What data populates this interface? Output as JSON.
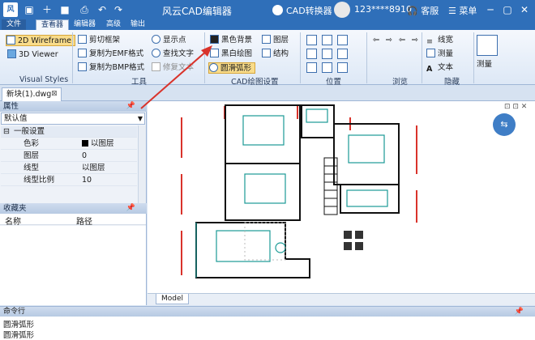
{
  "titlebar": {
    "logo": "风",
    "title": "风云CAD编辑器",
    "converter": "CAD转换器",
    "user": "123****8910",
    "service": "客服",
    "menu": "菜单",
    "quick_icons": [
      "open-icon",
      "new-icon",
      "save-icon",
      "print-icon",
      "undo-icon",
      "redo-icon"
    ]
  },
  "tabs": [
    "文件",
    "查看器",
    "编辑器",
    "高级",
    "输出"
  ],
  "ribbon": {
    "visual_styles": {
      "wireframe": "2D Wireframe",
      "viewer3d": "3D Viewer",
      "label": "Visual Styles"
    },
    "tools": {
      "clip": "剪切框架",
      "copy_emf": "复制为EMF格式",
      "copy_bmp": "复制为BMP格式",
      "show_points": "显示点",
      "find_text": "查找文字",
      "fix_text": "修复文本",
      "label": "工具"
    },
    "cad_settings": {
      "black_bg": "黑色背景",
      "bw_draw": "黑白绘图",
      "smooth_arc": "圆滑弧形",
      "layers": "图层",
      "structure": "结构",
      "label": "CAD绘图设置"
    },
    "position": {
      "label": "位置"
    },
    "browse": {
      "label": "浏览"
    },
    "hide": {
      "linewidth": "线宽",
      "measure": "测量",
      "text": "文本",
      "label": "隐藏"
    },
    "measure_big": "测量"
  },
  "document": {
    "tab": "新块(1).dwg"
  },
  "properties": {
    "title": "属性",
    "selected": "默认值",
    "group": "一般设置",
    "rows": [
      {
        "key": "色彩",
        "value": "以图层"
      },
      {
        "key": "图层",
        "value": "0"
      },
      {
        "key": "线型",
        "value": "以图层"
      },
      {
        "key": "线型比例",
        "value": "10"
      }
    ]
  },
  "favorites": {
    "title": "收藏夹",
    "col_name": "名称",
    "col_path": "路径"
  },
  "canvas": {
    "model_tab": "Model"
  },
  "command": {
    "title": "命令行",
    "lines": [
      "圆滑弧形",
      "圆滑弧形"
    ]
  },
  "colors": {
    "title_bar": "#2f6fb9",
    "accent": "#f9dc8a",
    "arrow": "#d9332b"
  }
}
